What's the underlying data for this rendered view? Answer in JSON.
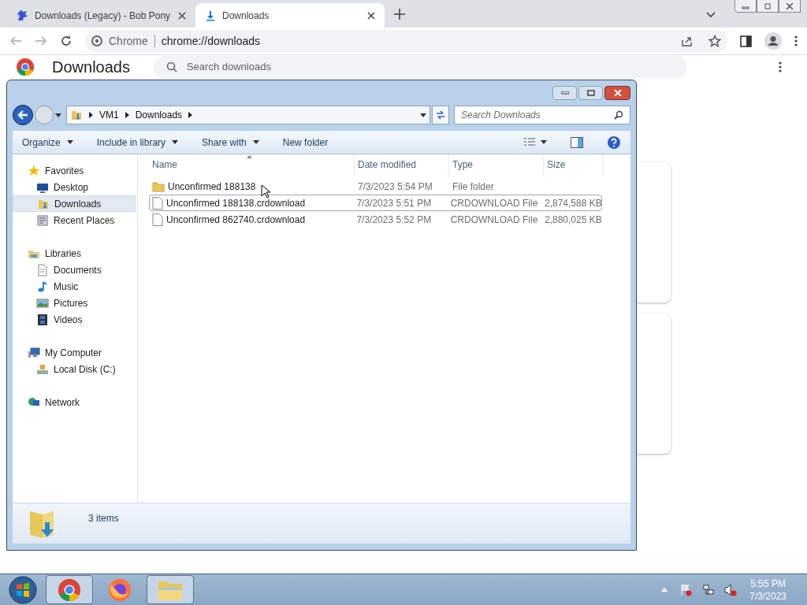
{
  "browser": {
    "tabs": [
      {
        "title": "Downloads (Legacy) - Bob Pony",
        "selected": false
      },
      {
        "title": "Downloads",
        "selected": true
      }
    ],
    "omnibox": {
      "site_label": "Chrome",
      "url": "chrome://downloads"
    }
  },
  "downloads_page": {
    "title": "Downloads",
    "search": {
      "placeholder": "Search downloads"
    }
  },
  "explorer": {
    "breadcrumb": [
      "VM1",
      "Downloads"
    ],
    "search": {
      "placeholder": "Search Downloads"
    },
    "commands": [
      {
        "label": "Organize",
        "dropdown": true
      },
      {
        "label": "Include in library",
        "dropdown": true
      },
      {
        "label": "Share with",
        "dropdown": true
      },
      {
        "label": "New folder",
        "dropdown": false
      }
    ],
    "nav": [
      {
        "label": "Favorites",
        "kind": "star",
        "selected": false,
        "children": [
          {
            "label": "Desktop",
            "kind": "desktop",
            "selected": false
          },
          {
            "label": "Downloads",
            "kind": "downloads",
            "selected": true
          },
          {
            "label": "Recent Places",
            "kind": "recent",
            "selected": false
          }
        ]
      },
      {
        "label": "Libraries",
        "kind": "library",
        "selected": false,
        "children": [
          {
            "label": "Documents",
            "kind": "document",
            "selected": false
          },
          {
            "label": "Music",
            "kind": "music",
            "selected": false
          },
          {
            "label": "Pictures",
            "kind": "pictures",
            "selected": false
          },
          {
            "label": "Videos",
            "kind": "videos",
            "selected": false
          }
        ]
      },
      {
        "label": "My Computer",
        "kind": "computer",
        "selected": false,
        "children": [
          {
            "label": "Local Disk (C:)",
            "kind": "disk",
            "selected": false
          }
        ]
      },
      {
        "label": "Network",
        "kind": "network",
        "selected": false
      }
    ],
    "columns": [
      "Name",
      "Date modified",
      "Type",
      "Size"
    ],
    "files": [
      {
        "kind": "folder",
        "name": "Unconfirmed 188138",
        "date": "7/3/2023 5:54 PM",
        "type": "File folder",
        "focused": false
      },
      {
        "kind": "file",
        "name": "Unconfirmed 188138.crdownload",
        "date": "7/3/2023 5:51 PM",
        "type": "CRDOWNLOAD File",
        "size": "2,874,588 KB",
        "focused": true
      },
      {
        "kind": "file",
        "name": "Unconfirmed 862740.crdownload",
        "date": "7/3/2023 5:52 PM",
        "type": "CRDOWNLOAD File",
        "size": "2,880,025 KB",
        "focused": false
      }
    ],
    "status": "3 items"
  },
  "taskbar": {
    "apps": [
      {
        "kind": "chrome",
        "running": true
      },
      {
        "kind": "firefox",
        "running": false
      },
      {
        "kind": "explorer",
        "running": true
      }
    ],
    "time": "5:55 PM",
    "date": "7/3/2023"
  }
}
